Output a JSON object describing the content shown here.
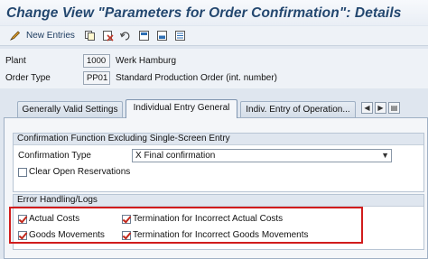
{
  "title": "Change View \"Parameters for Order Confirmation\": Details",
  "toolbar": {
    "new_entries": "New Entries"
  },
  "header": {
    "plant_label": "Plant",
    "plant_value": "1000",
    "plant_desc": "Werk Hamburg",
    "order_type_label": "Order Type",
    "order_type_value": "PP01",
    "order_type_desc": "Standard Production Order (int. number)"
  },
  "tabs": [
    {
      "label": "Generally Valid Settings",
      "active": false
    },
    {
      "label": "Individual Entry General",
      "active": true
    },
    {
      "label": "Indiv. Entry of Operation...",
      "active": false
    }
  ],
  "confirmation_group": {
    "title": "Confirmation Function Excluding Single-Screen Entry",
    "type_label": "Confirmation Type",
    "type_value": "X Final confirmation",
    "clear_reservations_label": "Clear Open Reservations",
    "clear_reservations_checked": false
  },
  "error_group": {
    "title": "Error Handling/Logs",
    "items": [
      {
        "label": "Actual Costs",
        "checked": true
      },
      {
        "label": "Termination for Incorrect Actual Costs",
        "checked": true
      },
      {
        "label": "Goods Movements",
        "checked": true
      },
      {
        "label": "Termination for Incorrect Goods Movements",
        "checked": true
      }
    ]
  },
  "colors": {
    "title": "#23476f",
    "highlight": "#d11c1c",
    "check": "#c2271b"
  }
}
